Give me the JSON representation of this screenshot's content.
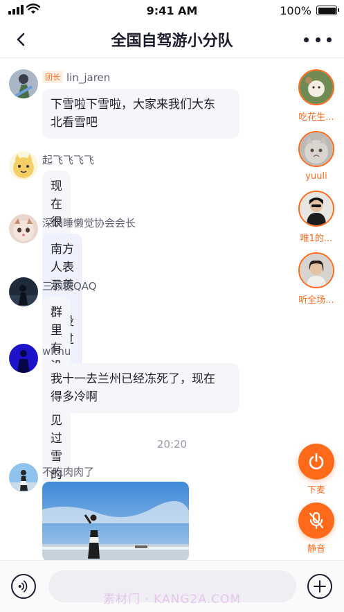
{
  "status_bar": {
    "time": "9:41 AM",
    "battery": "100%"
  },
  "header": {
    "title": "全国自驾游小分队"
  },
  "messages": [
    {
      "sender": "lin_jaren",
      "badge": "团长",
      "text_line1": "下雪啦下雪啦，大家来我们大东",
      "text_line2": "北看雪吧"
    },
    {
      "sender": "起飞飞飞飞",
      "text": "现在很冷吧"
    },
    {
      "sender": "深圳睡懒觉协会会长",
      "text": "南方人表示羡慕，真没见过呀!"
    },
    {
      "sender": "三颗糖QAQ",
      "text": "群里有没有没见过雪的小伙伴"
    },
    {
      "sender": "withu",
      "text_line1": "我十一去兰州已经冻死了，现在",
      "text_line2": "得多冷啊"
    },
    {
      "sender": "不吃肉肉了"
    }
  ],
  "timestamp": "20:20",
  "speakers": [
    {
      "name": "吃花生..."
    },
    {
      "name": "yuuli"
    },
    {
      "name": "唯1的..."
    },
    {
      "name": "听全场..."
    }
  ],
  "controls": {
    "leave_label": "下麦",
    "mute_label": "静音"
  },
  "composer": {
    "placeholder": "",
    "watermark": "素材门 · KANG2A.COM"
  },
  "colors": {
    "accent": "#ff6a1a",
    "bubble": "#f5f6fa",
    "bubble_highlight": "#eef1fd"
  },
  "icons": [
    "back-arrow-icon",
    "more-dots-icon",
    "power-icon",
    "mic-off-icon",
    "voice-icon",
    "plus-icon"
  ]
}
